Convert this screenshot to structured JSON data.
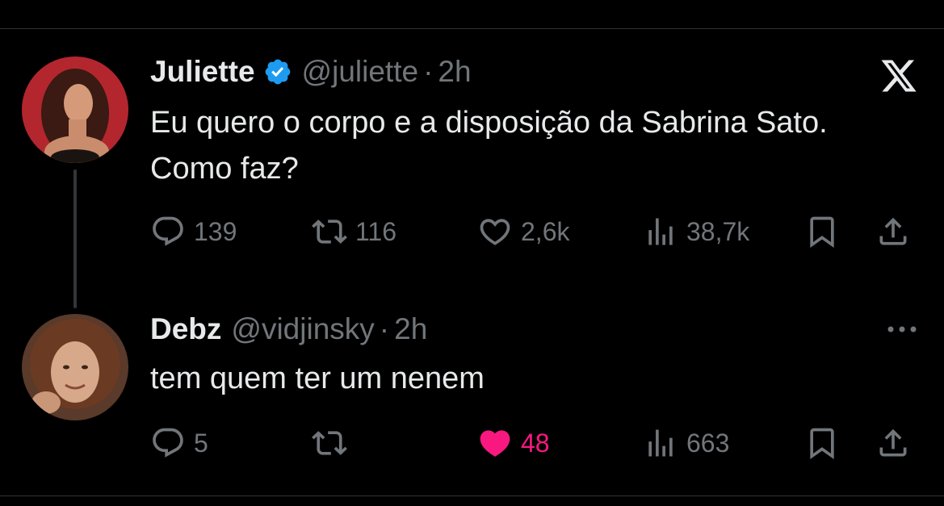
{
  "platform_logo": "x-logo",
  "tweet": {
    "author_name": "Juliette",
    "verified": true,
    "handle": "@juliette",
    "time": "2h",
    "text": "Eu quero o corpo e a disposição da Sabrina Sato. Como faz?",
    "replies": "139",
    "reposts": "116",
    "likes": "2,6k",
    "views": "38,7k",
    "liked": false
  },
  "reply": {
    "author_name": "Debz",
    "handle": "@vidjinsky",
    "time": "2h",
    "text": "tem quem ter um nenem",
    "replies": "5",
    "reposts": "",
    "likes": "48",
    "views": "663",
    "liked": true
  },
  "colors": {
    "background": "#000000",
    "text": "#e7e9ea",
    "muted": "#71767b",
    "like_active": "#f91880",
    "verified": "#1d9bf0"
  }
}
